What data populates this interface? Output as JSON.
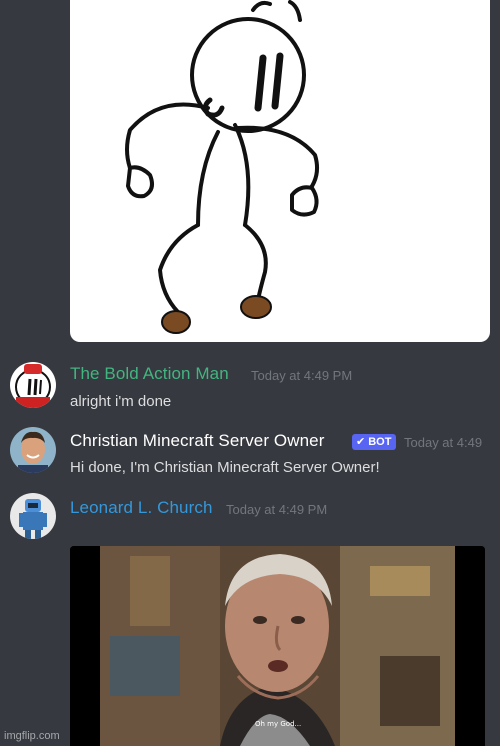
{
  "colors": {
    "background": "#36393f",
    "timestamp": "#72767d",
    "message_text": "#dcddde",
    "bot_badge": "#5865f2"
  },
  "top_image": {
    "alt_icon": "stickman-figure-icon"
  },
  "messages": [
    {
      "username": "The Bold Action Man",
      "username_color": "#43b581",
      "timestamp": "Today at 4:49 PM",
      "text": "alright i'm done",
      "avatar_icon": "henry-stickmin-avatar-icon"
    },
    {
      "username": "Christian Minecraft Server Owner",
      "username_color": "#ffffff",
      "badge": "BOT",
      "timestamp": "Today at 4:49",
      "text": "Hi done, I'm Christian Minecraft Server Owner!",
      "avatar_icon": "smiling-man-avatar-icon"
    },
    {
      "username": "Leonard L. Church",
      "username_color": "#3498db",
      "timestamp": "Today at 4:49 PM",
      "avatar_icon": "soldier-avatar-icon"
    }
  ],
  "embed": {
    "caption": "Oh my God...",
    "image_icon": "old-man-movie-still-icon"
  },
  "watermark": "imgflip.com"
}
